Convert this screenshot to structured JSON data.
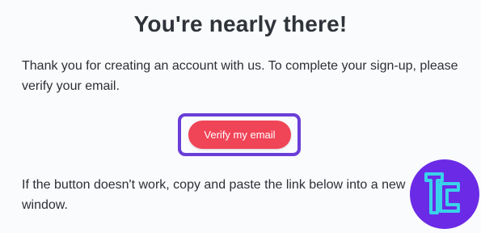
{
  "email": {
    "title": "You're nearly there!",
    "intro": "Thank you for creating an account with us. To complete your sign-up, please verify your email.",
    "verify_button": "Verify my email",
    "fallback": "If the button doesn't work, copy and paste the link below into a new window."
  },
  "brand": {
    "logo_icon": "tc-logo-icon",
    "button_color": "#f04457",
    "focus_color": "#6a3ed8",
    "badge_color": "#6b2ae6",
    "logo_stroke": "#3ad2ea"
  }
}
